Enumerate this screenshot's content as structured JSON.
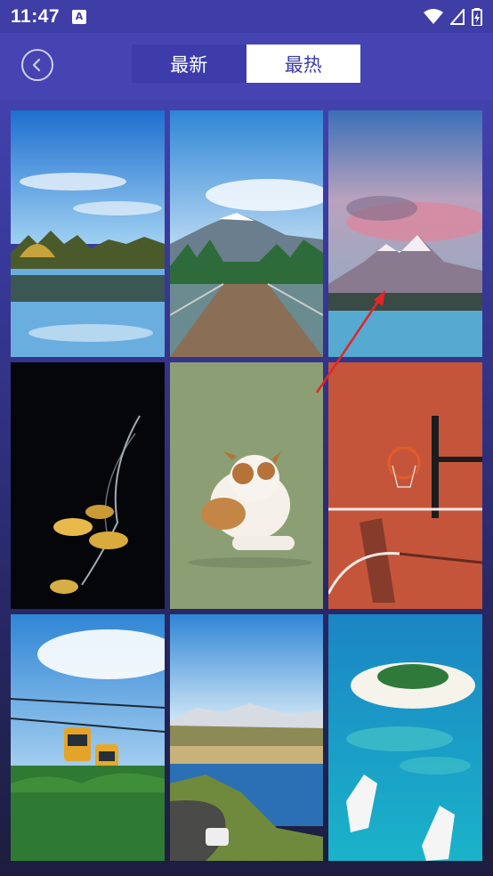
{
  "status_bar": {
    "time": "11:47",
    "notification_icon": "accessibility-icon",
    "icons": [
      "wifi-icon",
      "signal-icon",
      "battery-icon"
    ]
  },
  "header": {
    "back_icon": "back-arrow-icon",
    "tabs": [
      {
        "label": "最新",
        "selected": false
      },
      {
        "label": "最热",
        "selected": true
      }
    ]
  },
  "wallpapers": [
    {
      "subject": "lake-reflection"
    },
    {
      "subject": "boardwalk-bridge"
    },
    {
      "subject": "snowy-mountain"
    },
    {
      "subject": "jellyfish"
    },
    {
      "subject": "dog"
    },
    {
      "subject": "basketball-hoop"
    },
    {
      "subject": "cable-car"
    },
    {
      "subject": "lakeside-road"
    },
    {
      "subject": "island-boats"
    }
  ],
  "colors": {
    "header_bg": "#4544b2",
    "tab_selected_bg": "#ffffff",
    "tab_unselected_bg": "#3d3caa",
    "annotation_arrow": "#e3262a"
  }
}
